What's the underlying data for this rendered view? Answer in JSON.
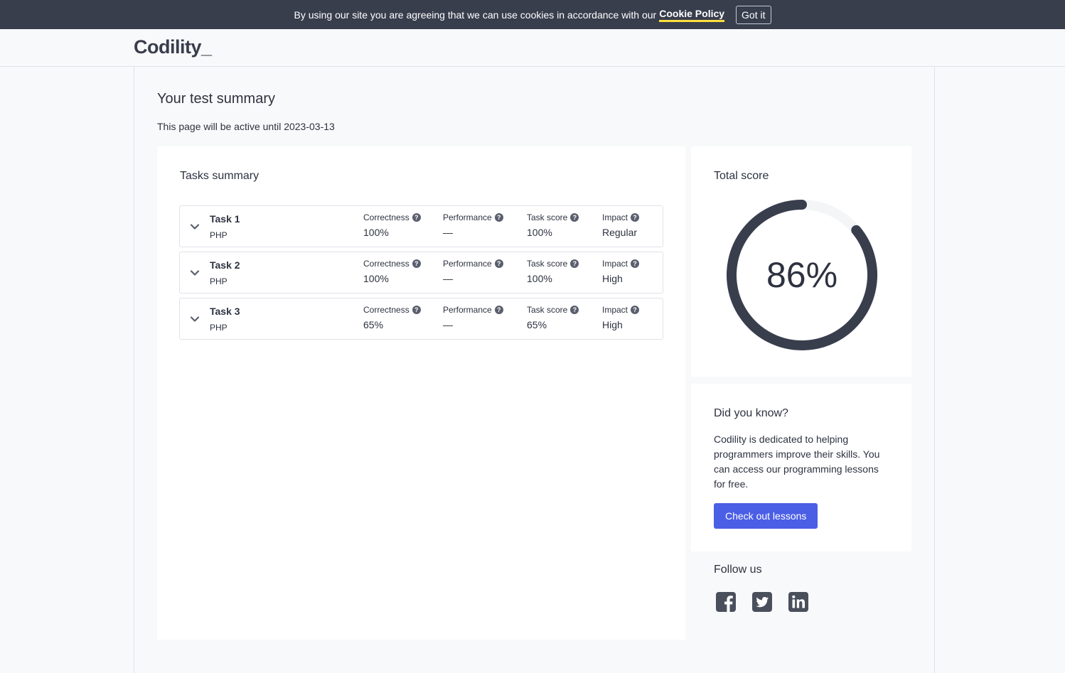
{
  "cookie": {
    "text": "By using our site you are agreeing that we can use cookies in accordance with our",
    "link_label": "Cookie Policy",
    "button_label": "Got it"
  },
  "header": {
    "logo": "Codility_"
  },
  "page": {
    "title": "Your test summary",
    "active_until": "This page will be active until 2023-03-13"
  },
  "tasks": {
    "title": "Tasks summary",
    "labels": {
      "correctness": "Correctness",
      "performance": "Performance",
      "task_score": "Task score",
      "impact": "Impact"
    },
    "help_glyph": "?",
    "rows": [
      {
        "name": "Task 1",
        "lang": "PHP",
        "correctness": "100%",
        "performance": "—",
        "task_score": "100%",
        "impact": "Regular"
      },
      {
        "name": "Task 2",
        "lang": "PHP",
        "correctness": "100%",
        "performance": "—",
        "task_score": "100%",
        "impact": "High"
      },
      {
        "name": "Task 3",
        "lang": "PHP",
        "correctness": "65%",
        "performance": "—",
        "task_score": "65%",
        "impact": "High"
      }
    ]
  },
  "score": {
    "title": "Total score",
    "value_text": "86%",
    "value": 86,
    "ring_color": "#393e4d",
    "track_color": "#f4f5f7"
  },
  "know": {
    "title": "Did you know?",
    "text": "Codility is dedicated to helping programmers improve their skills. You can access our programming lessons for free.",
    "button_label": "Check out lessons"
  },
  "follow": {
    "title": "Follow us",
    "icons": [
      "facebook-icon",
      "twitter-icon",
      "linkedin-icon"
    ]
  },
  "colors": {
    "accent": "#4b5ee6",
    "cookie_bar": "#393e4d",
    "cookie_underline": "#ffe03d"
  }
}
